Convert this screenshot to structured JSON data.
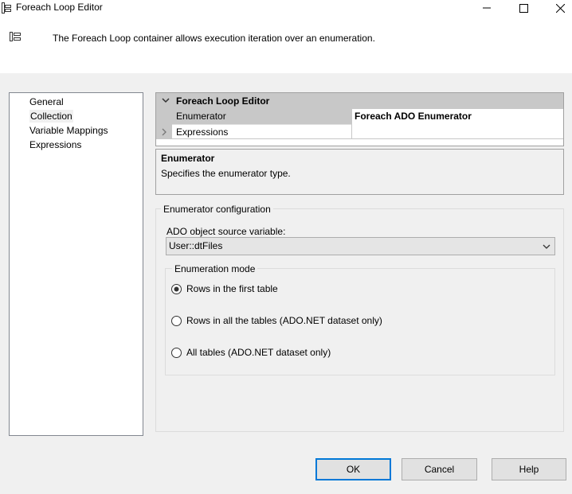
{
  "window": {
    "title": "Foreach Loop Editor"
  },
  "header": {
    "description": "The Foreach Loop container allows execution iteration over an enumeration."
  },
  "nav": {
    "items": [
      {
        "label": "General"
      },
      {
        "label": "Collection"
      },
      {
        "label": "Variable Mappings"
      },
      {
        "label": "Expressions"
      }
    ],
    "selected": "Collection"
  },
  "property_grid": {
    "category": "Foreach Loop Editor",
    "rows": [
      {
        "name": "Enumerator",
        "value": "Foreach ADO Enumerator"
      },
      {
        "name": "Expressions",
        "value": ""
      }
    ]
  },
  "description_panel": {
    "title": "Enumerator",
    "text": "Specifies the enumerator type."
  },
  "config": {
    "group_label": "Enumerator configuration",
    "source_label": "ADO object source variable:",
    "source_value": "User::dtFiles",
    "mode_label": "Enumeration mode",
    "modes": [
      {
        "label": "Rows in the first table",
        "checked": true
      },
      {
        "label": "Rows in all the tables (ADO.NET dataset only)",
        "checked": false
      },
      {
        "label": "All tables (ADO.NET dataset only)",
        "checked": false
      }
    ]
  },
  "buttons": {
    "ok": "OK",
    "cancel": "Cancel",
    "help": "Help"
  },
  "colors": {
    "accent": "#0078d7",
    "window_bg": "#f0f0f0",
    "grid_category": "#c8c8c8"
  }
}
